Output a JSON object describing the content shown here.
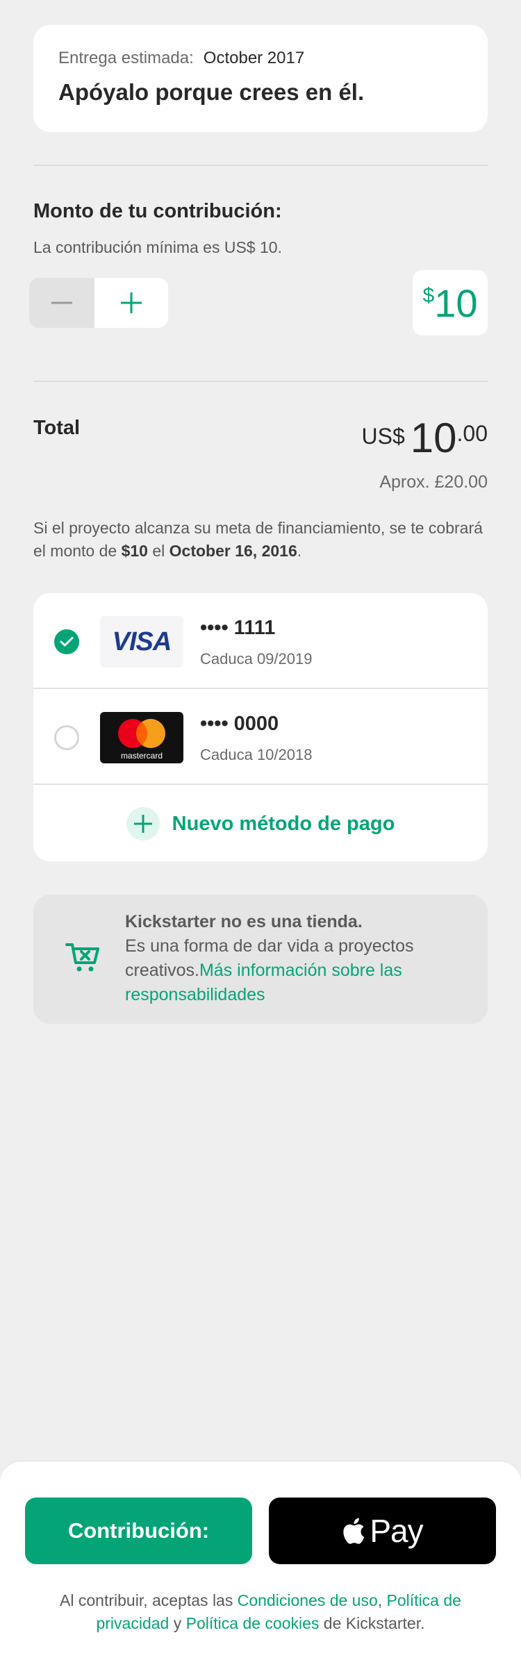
{
  "header": {
    "delivery_label": "Entrega estimada:",
    "delivery_date": "October 2017",
    "title": "Apóyalo porque crees en él."
  },
  "pledge": {
    "title": "Monto de tu contribución:",
    "minimum_note": "La contribución mínima es US$ 10.",
    "amount_currency": "$",
    "amount_value": "10"
  },
  "total": {
    "label": "Total",
    "currency": "US$",
    "whole": "10",
    "cents": ".00",
    "approx": "Aprox. £20.00"
  },
  "charge_note": {
    "before": "Si el proyecto alcanza su meta de financiamiento, se te cobrará el monto de ",
    "amount": "$10",
    "middle": " el ",
    "date": "October 16, 2016",
    "after": "."
  },
  "payment_methods": [
    {
      "brand": "VISA",
      "number": "•••• 1111",
      "expiry": "Caduca 09/2019",
      "selected": true
    },
    {
      "brand": "mastercard",
      "number": "•••• 0000",
      "expiry": "Caduca 10/2018",
      "selected": false
    }
  ],
  "new_payment_label": "Nuevo método de pago",
  "info": {
    "title": "Kickstarter no es una tienda.",
    "body": "Es una forma de dar vida a proyectos creativos.",
    "link": "Más información sobre las responsabilidades"
  },
  "footer": {
    "pledge_button": "Contribución:",
    "applepay_label": "Pay",
    "terms_1": "Al contribuir, aceptas las ",
    "terms_link_1": "Condiciones de uso",
    "terms_2": ", ",
    "terms_link_2": "Política de privacidad",
    "terms_3": " y ",
    "terms_link_3": "Política de cookies",
    "terms_4": " de Kickstarter."
  },
  "colors": {
    "accent": "#05a477",
    "background": "#efefef"
  }
}
